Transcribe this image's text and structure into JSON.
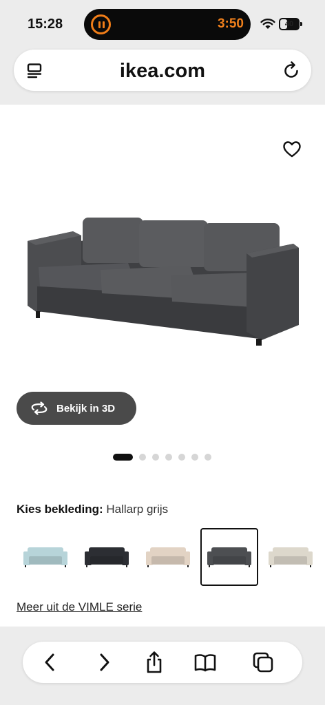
{
  "status_bar": {
    "time": "15:28",
    "island_timer": "3:50",
    "battery": "40",
    "battery_level": 0.4,
    "island_icon": "pause-icon",
    "accent_color": "#f07d18"
  },
  "browser": {
    "url": "ikea.com",
    "left_icon": "reader-icon",
    "right_icon": "reload-icon"
  },
  "product": {
    "favorite_icon": "heart-icon",
    "view_3d_label": "Bekijk in 3D",
    "image_count": 7,
    "active_image": 1
  },
  "upholstery": {
    "label": "Kies bekleding:",
    "value": "Hallarp grijs",
    "options": [
      {
        "color": "#b7d4d9",
        "selected": false
      },
      {
        "color": "#2c2e33",
        "selected": false
      },
      {
        "color": "#e2d3c4",
        "selected": false
      },
      {
        "color": "#4d4f52",
        "selected": true
      },
      {
        "color": "#ddd8cc",
        "selected": false
      }
    ]
  },
  "series_link": "Meer uit de VIMLE serie",
  "toolbar": {
    "buttons": [
      "back-icon",
      "forward-icon",
      "share-icon",
      "bookmarks-icon",
      "tabs-icon"
    ]
  }
}
